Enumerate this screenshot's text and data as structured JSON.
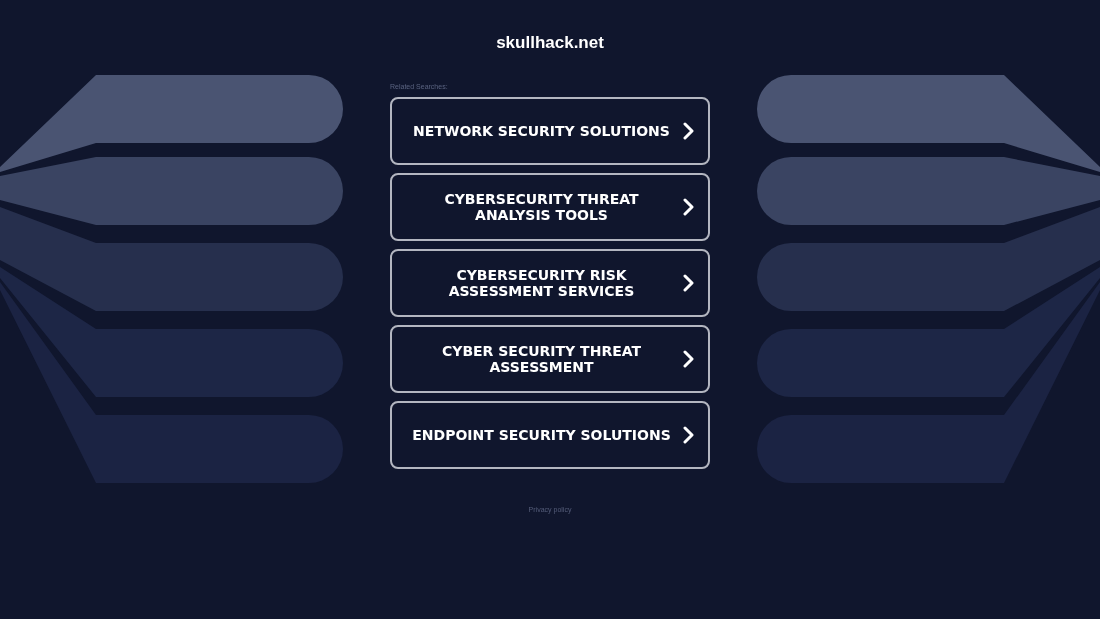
{
  "site_title": "skullhack.net",
  "related_searches": {
    "label": "Related Searches:",
    "items": [
      {
        "text": "NETWORK SECURITY SOLUTIONS"
      },
      {
        "text": "CYBERSECURITY THREAT ANALYSIS TOOLS"
      },
      {
        "text": "CYBERSECURITY RISK ASSESSMENT SERVICES"
      },
      {
        "text": "CYBER SECURITY THREAT ASSESSMENT"
      },
      {
        "text": "ENDPOINT SECURITY SOLUTIONS"
      }
    ]
  },
  "footer": {
    "privacy_link": "Privacy policy"
  }
}
